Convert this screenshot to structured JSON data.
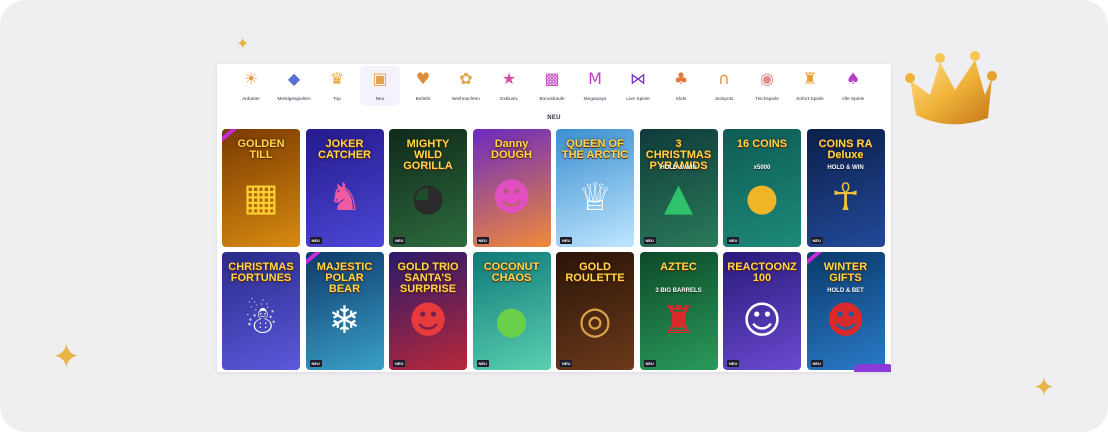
{
  "categories": [
    {
      "label": "Anbieter",
      "icon": "sun-icon",
      "glyph": "☀",
      "color": "#e7994a"
    },
    {
      "label": "Meistgespielten",
      "icon": "diamond-icon",
      "glyph": "◆",
      "color": "#5b6fd8"
    },
    {
      "label": "Top",
      "icon": "crown-icon",
      "glyph": "♛",
      "color": "#e9a334"
    },
    {
      "label": "Neu",
      "icon": "gift-box-icon",
      "glyph": "▣",
      "color": "#e8a04a"
    },
    {
      "label": "Beliebt",
      "icon": "strawberry-icon",
      "glyph": "♥",
      "color": "#e28a3c"
    },
    {
      "label": "Weihnachten",
      "icon": "gift-bow-icon",
      "glyph": "✿",
      "color": "#e0a64a"
    },
    {
      "label": "Exklusiv",
      "icon": "star-icon",
      "glyph": "★",
      "color": "#d94ea8"
    },
    {
      "label": "Bonuskäufe",
      "icon": "present-icon",
      "glyph": "▩",
      "color": "#c64ec4"
    },
    {
      "label": "Megaways",
      "icon": "m-letter-icon",
      "glyph": "M",
      "color": "#c13ec9"
    },
    {
      "label": "Live Spiele",
      "icon": "bowtie-icon",
      "glyph": "⋈",
      "color": "#7a37c9"
    },
    {
      "label": "Slots",
      "icon": "cherries-icon",
      "glyph": "♣",
      "color": "#e07c3b"
    },
    {
      "label": "Jackpots",
      "icon": "horseshoe-icon",
      "glyph": "∩",
      "color": "#e88a3a"
    },
    {
      "label": "Tischspiele",
      "icon": "donut-icon",
      "glyph": "◉",
      "color": "#e48b8b"
    },
    {
      "label": "Sofort-Spiele",
      "icon": "joystick-icon",
      "glyph": "♜",
      "color": "#e9a03a"
    },
    {
      "label": "Alle Spiele",
      "icon": "cards-icon",
      "glyph": "♠",
      "color": "#b53ec5"
    }
  ],
  "active_category": "Neu",
  "section_title": "NEU",
  "games": [
    {
      "title": "GOLDEN TILL",
      "subtitle": "",
      "bg": [
        "#7a3a00",
        "#d88a10"
      ],
      "art": "▦",
      "art_color": "#ffcf33",
      "new": false,
      "ribbon": true
    },
    {
      "title": "JOKER CATCHER",
      "subtitle": "",
      "bg": [
        "#241a8c",
        "#4d47d6"
      ],
      "art": "♞",
      "art_color": "#f05aa0",
      "new": true,
      "ribbon": false
    },
    {
      "title": "MIGHTY WILD GORILLA",
      "subtitle": "",
      "bg": [
        "#0f2a1c",
        "#2d6b3c"
      ],
      "art": "◕",
      "art_color": "#2a2a2a",
      "new": true,
      "ribbon": false
    },
    {
      "title": "Danny DOUGH",
      "subtitle": "",
      "bg": [
        "#6a2ac0",
        "#f08a3a"
      ],
      "art": "☻",
      "art_color": "#e34fc3",
      "new": true,
      "ribbon": false
    },
    {
      "title": "QUEEN OF THE ARCTIC",
      "subtitle": "",
      "bg": [
        "#3a8fd0",
        "#bfe6ff"
      ],
      "art": "♕",
      "art_color": "#ffffff",
      "new": true,
      "ribbon": false
    },
    {
      "title": "3 CHRISTMAS PYRAMIDS",
      "subtitle": "HOLD & WIN",
      "bg": [
        "#0f3b3a",
        "#2b7a5a"
      ],
      "art": "▲",
      "art_color": "#2ec26a",
      "new": true,
      "ribbon": false
    },
    {
      "title": "16 COINS",
      "subtitle": "x5000",
      "bg": [
        "#0e5b55",
        "#1d8a7a"
      ],
      "art": "●",
      "art_color": "#f0b628",
      "new": true,
      "ribbon": false
    },
    {
      "title": "COINS RA Deluxe",
      "subtitle": "HOLD & WIN",
      "bg": [
        "#0a1f4a",
        "#234a99"
      ],
      "art": "☥",
      "art_color": "#f0c23a",
      "new": true,
      "ribbon": false
    },
    {
      "title": "CHRISTMAS FORTUNES",
      "subtitle": "",
      "bg": [
        "#2a2a8a",
        "#5a5adb"
      ],
      "art": "☃",
      "art_color": "#ffffff",
      "new": false,
      "ribbon": false
    },
    {
      "title": "MAJESTIC POLAR BEAR",
      "subtitle": "",
      "bg": [
        "#0d3a6a",
        "#3aa0c8"
      ],
      "art": "❄",
      "art_color": "#ffffff",
      "new": true,
      "ribbon": true
    },
    {
      "title": "GOLD TRIO SANTA'S SURPRISE",
      "subtitle": "",
      "bg": [
        "#2b1a6a",
        "#b7283a"
      ],
      "art": "☻",
      "art_color": "#e83a3a",
      "new": true,
      "ribbon": false
    },
    {
      "title": "COCONUT CHAOS",
      "subtitle": "",
      "bg": [
        "#0f7a7a",
        "#5ad0b0"
      ],
      "art": "●",
      "art_color": "#6ad04a",
      "new": true,
      "ribbon": false
    },
    {
      "title": "GOLD ROULETTE",
      "subtitle": "",
      "bg": [
        "#2a1408",
        "#6b3a1a"
      ],
      "art": "◎",
      "art_color": "#d8a24a",
      "new": true,
      "ribbon": false
    },
    {
      "title": "AZTEC",
      "subtitle": "3 BIG BARRELS",
      "bg": [
        "#0d4a2a",
        "#2a9a5a"
      ],
      "art": "♜",
      "art_color": "#d82a2a",
      "new": true,
      "ribbon": false
    },
    {
      "title": "REACTOONZ 100",
      "subtitle": "",
      "bg": [
        "#2a1a7a",
        "#6a4ad0"
      ],
      "art": "☺",
      "art_color": "#ffffff",
      "new": true,
      "ribbon": false
    },
    {
      "title": "WINTER GIFTS",
      "subtitle": "HOLD & BET",
      "bg": [
        "#0a3a6a",
        "#2a7ac8"
      ],
      "art": "☻",
      "art_color": "#d82a2a",
      "new": true,
      "ribbon": true
    }
  ],
  "new_badge_label": "NEU"
}
